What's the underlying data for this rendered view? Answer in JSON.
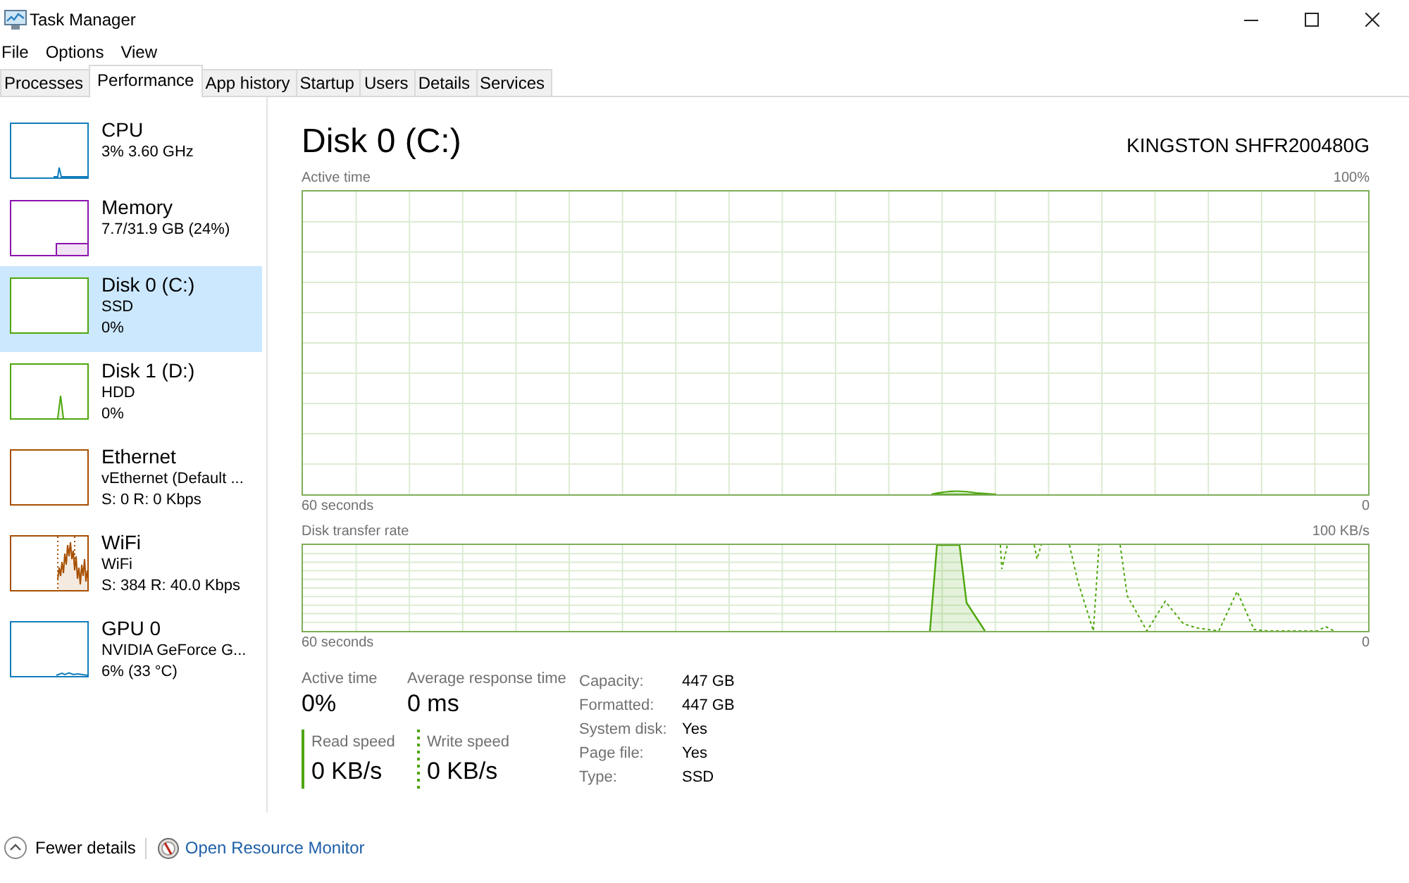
{
  "window": {
    "title": "Task Manager"
  },
  "menu": [
    "File",
    "Options",
    "View"
  ],
  "tabs": [
    {
      "label": "Processes",
      "selected": false
    },
    {
      "label": "Performance",
      "selected": true
    },
    {
      "label": "App history",
      "selected": false
    },
    {
      "label": "Startup",
      "selected": false
    },
    {
      "label": "Users",
      "selected": false
    },
    {
      "label": "Details",
      "selected": false
    },
    {
      "label": "Services",
      "selected": false
    }
  ],
  "sidebar": {
    "items": [
      {
        "name": "CPU",
        "details": [
          "3% 3.60 GHz"
        ],
        "color": "#117dbb",
        "kind": "blip",
        "selected": false
      },
      {
        "name": "Memory",
        "details": [
          "7.7/31.9 GB (24%)"
        ],
        "color": "#8b12ae",
        "kind": "step",
        "selected": false
      },
      {
        "name": "Disk 0 (C:)",
        "details": [
          "SSD",
          "0%"
        ],
        "color": "#4da60c",
        "kind": "flat",
        "selected": true
      },
      {
        "name": "Disk 1 (D:)",
        "details": [
          "HDD",
          "0%"
        ],
        "color": "#4da60c",
        "kind": "spike",
        "selected": false
      },
      {
        "name": "Ethernet",
        "details": [
          "vEthernet (Default ...",
          "S: 0 R: 0 Kbps"
        ],
        "color": "#a74f01",
        "kind": "flat",
        "selected": false
      },
      {
        "name": "WiFi",
        "details": [
          "WiFi",
          "S: 384 R: 40.0 Kbps"
        ],
        "color": "#a74f01",
        "kind": "busy",
        "selected": false
      },
      {
        "name": "GPU 0",
        "details": [
          "NVIDIA GeForce G...",
          "6% (33 °C)"
        ],
        "color": "#117dbb",
        "kind": "ripple",
        "selected": false
      }
    ]
  },
  "performance": {
    "title": "Disk 0 (C:)",
    "model": "KINGSTON SHFR200480G",
    "graphs": [
      {
        "kind": "activity",
        "label": "Active time",
        "max": "100%",
        "span": "60 seconds",
        "min": "0"
      },
      {
        "kind": "transfer",
        "label": "Disk transfer rate",
        "max": "100 KB/s",
        "span": "60 seconds",
        "min": "0"
      }
    ],
    "stats": [
      {
        "label": "Active time",
        "value": "0%"
      },
      {
        "label": "Average response time",
        "value": "0 ms"
      }
    ],
    "speeds": [
      {
        "kind": "solid",
        "label": "Read speed",
        "value": "0 KB/s"
      },
      {
        "kind": "dotted",
        "label": "Write speed",
        "value": "0 KB/s"
      }
    ],
    "properties": [
      {
        "label": "Capacity:",
        "value": "447 GB"
      },
      {
        "label": "Formatted:",
        "value": "447 GB"
      },
      {
        "label": "System disk:",
        "value": "Yes"
      },
      {
        "label": "Page file:",
        "value": "Yes"
      },
      {
        "label": "Type:",
        "value": "SSD"
      }
    ]
  },
  "footer": {
    "toggle": "Fewer details",
    "link": "Open Resource Monitor"
  }
}
